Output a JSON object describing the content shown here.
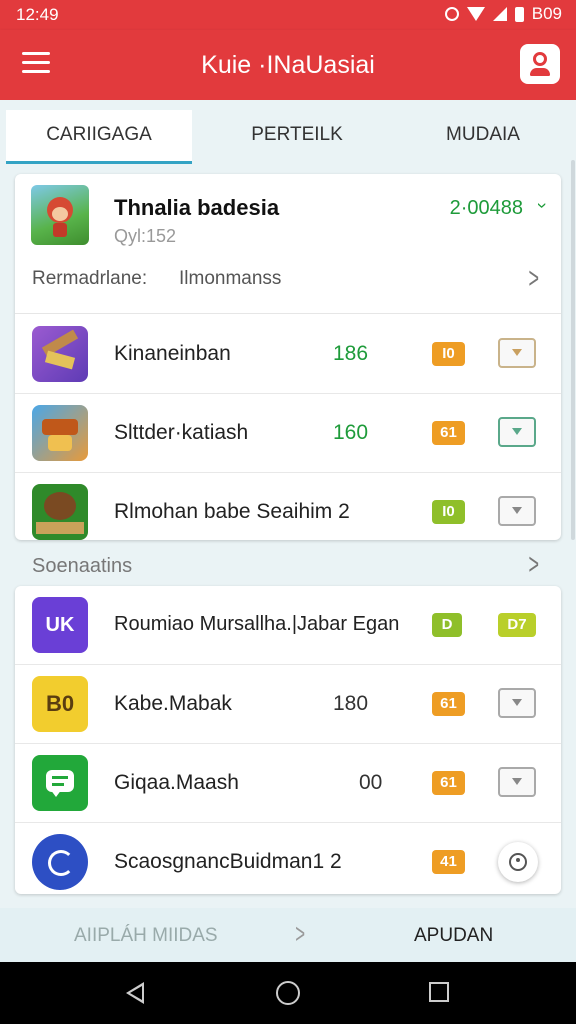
{
  "status": {
    "time": "12:49",
    "right_text": "B09"
  },
  "app": {
    "title": "Kuie ·INaUasiai"
  },
  "tabs": [
    {
      "label": "CARIIGAGA",
      "active": true
    },
    {
      "label": "PERTEILK",
      "active": false
    },
    {
      "label": "MUDAIA",
      "active": false
    }
  ],
  "featured": {
    "title": "Thnalia badesia",
    "subtitle": "Qyl:152",
    "count": "2·00488",
    "rec_label": "Rermadrlane:",
    "rec_value": "Ilmonmanss"
  },
  "games": [
    {
      "name": "Kinaneinban",
      "count": "186",
      "badge": "I0",
      "badge_color": "#ee9d24",
      "action_style": "beige"
    },
    {
      "name": "Slttder·katiash",
      "count": "160",
      "badge": "61",
      "badge_color": "#ee9d24",
      "action_style": "green"
    },
    {
      "name": "Rlmohan babe Seaihim 2",
      "count": "",
      "badge": "I0",
      "badge_color": "#8fbf2a",
      "action_style": "gray"
    }
  ],
  "section": {
    "title": "Soenaatins"
  },
  "apps": [
    {
      "name": "Roumiao Mursallha.|Jabar Egan",
      "icon_text": "UK",
      "badge": "D",
      "badge_color": "#8fbf2a",
      "badge2": "D7",
      "badge2_color": "#b9cf2a"
    },
    {
      "name": "Kabe.Mabak",
      "icon_text": "B0",
      "count": "180",
      "badge": "61",
      "badge_color": "#ee9d24"
    },
    {
      "name": "Giqaa.Maash",
      "count": "00",
      "badge": "61",
      "badge_color": "#ee9d24"
    },
    {
      "name": "ScaosgnancBuidman1 2",
      "badge": "41",
      "badge_color": "#ee9d24"
    }
  ],
  "bottom_nav": {
    "left": "AIIPLÁH MIIDAS",
    "right": "APUDAN"
  },
  "colors": {
    "primary": "#e23a3d",
    "accent": "#33a3c4",
    "green_text": "#1e9b3a",
    "orange_badge": "#ee9d24"
  }
}
